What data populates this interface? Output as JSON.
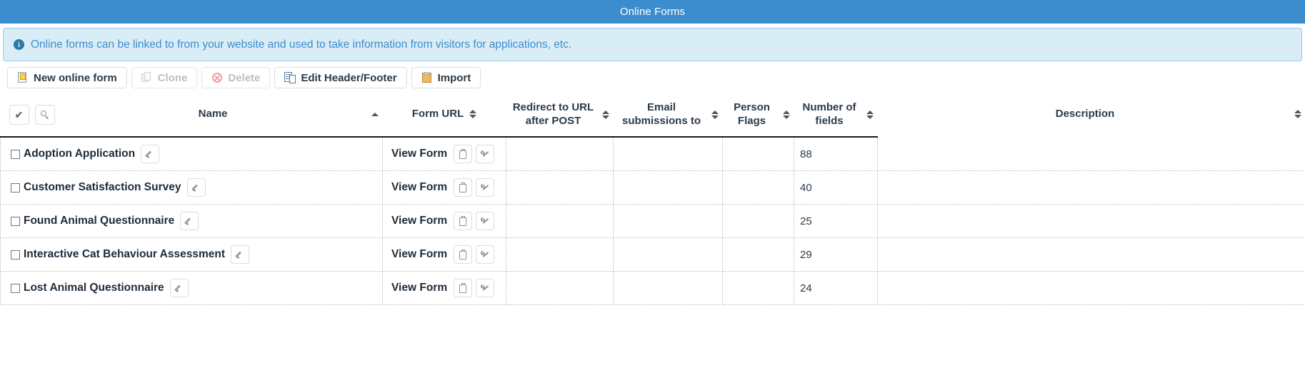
{
  "window": {
    "title": "Online Forms"
  },
  "alert": {
    "icon": "info-icon",
    "text": "Online forms can be linked to from your website and used to take information from visitors for applications, etc."
  },
  "toolbar": {
    "buttons": [
      {
        "label": "New online form",
        "icon": "new-form-icon",
        "disabled": false
      },
      {
        "label": "Clone",
        "icon": "clone-icon",
        "disabled": true
      },
      {
        "label": "Delete",
        "icon": "delete-icon",
        "disabled": true
      },
      {
        "label": "Edit Header/Footer",
        "icon": "edit-header-footer-icon",
        "disabled": false
      },
      {
        "label": "Import",
        "icon": "import-icon",
        "disabled": false
      }
    ]
  },
  "table": {
    "tools": {
      "select_all_icon": "check-icon",
      "filter_icon": "search-icon"
    },
    "columns": [
      {
        "label": "Name",
        "sortable": true,
        "sorted": "asc"
      },
      {
        "label": "Form URL",
        "sortable": true,
        "sorted": "none"
      },
      {
        "label": "Redirect to URL after POST",
        "sortable": true,
        "sorted": "none"
      },
      {
        "label": "Email submissions to",
        "sortable": true,
        "sorted": "none"
      },
      {
        "label": "Person Flags",
        "sortable": true,
        "sorted": "none"
      },
      {
        "label": "Number of fields",
        "sortable": true,
        "sorted": "none"
      },
      {
        "label": "Description",
        "sortable": true,
        "sorted": "none"
      }
    ],
    "row_action_labels": {
      "view_form": "View Form",
      "edit_icon": "pencil-icon",
      "copy_icon": "clipboard-icon",
      "settings_icon": "wrench-icon"
    },
    "rows": [
      {
        "name": "Adoption Application",
        "form_url": "View Form",
        "redirect_url": "",
        "email_submissions": "",
        "person_flags": "",
        "number_of_fields": "88",
        "description": ""
      },
      {
        "name": "Customer Satisfaction Survey",
        "form_url": "View Form",
        "redirect_url": "",
        "email_submissions": "",
        "person_flags": "",
        "number_of_fields": "40",
        "description": ""
      },
      {
        "name": "Found Animal Questionnaire",
        "form_url": "View Form",
        "redirect_url": "",
        "email_submissions": "",
        "person_flags": "",
        "number_of_fields": "25",
        "description": ""
      },
      {
        "name": "Interactive Cat Behaviour Assessment",
        "form_url": "View Form",
        "redirect_url": "",
        "email_submissions": "",
        "person_flags": "",
        "number_of_fields": "29",
        "description": ""
      },
      {
        "name": "Lost Animal Questionnaire",
        "form_url": "View Form",
        "redirect_url": "",
        "email_submissions": "",
        "person_flags": "",
        "number_of_fields": "24",
        "description": ""
      }
    ]
  },
  "colors": {
    "titlebar": "#3c8dcd",
    "alert_bg": "#d9edf7",
    "alert_text": "#3c8dcd",
    "text": "#2b3a48"
  }
}
